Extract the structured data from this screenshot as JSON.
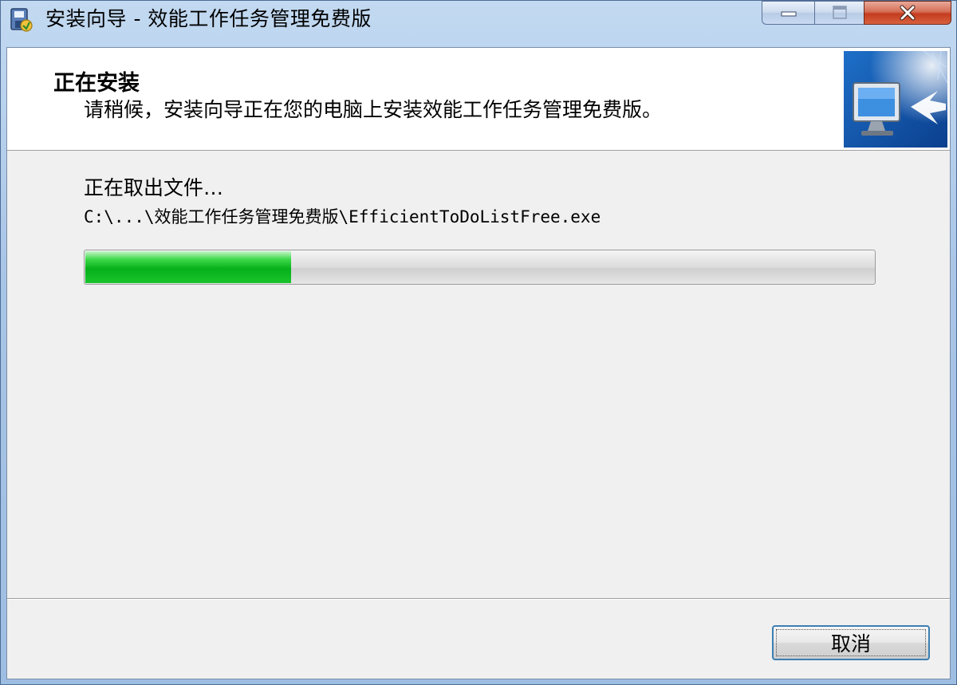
{
  "window": {
    "title": "安装向导 - 效能工作任务管理免费版"
  },
  "header": {
    "title": "正在安装",
    "subtitle": "请稍候，安装向导正在您的电脑上安装效能工作任务管理免费版。"
  },
  "main": {
    "status_label": "正在取出文件…",
    "file_path": "C:\\...\\效能工作任务管理免费版\\EfficientToDoListFree.exe",
    "progress_fraction": 0.26
  },
  "footer": {
    "cancel_label": "取消"
  },
  "colors": {
    "progress_green": "#06b01a",
    "title_bar": "#a9c5e6",
    "close_red": "#c43b1e"
  },
  "icons": {
    "app": "installer-disk-icon",
    "header": "computer-arrow-icon",
    "minimize": "minimize-icon",
    "maximize": "maximize-icon",
    "close": "close-icon"
  }
}
